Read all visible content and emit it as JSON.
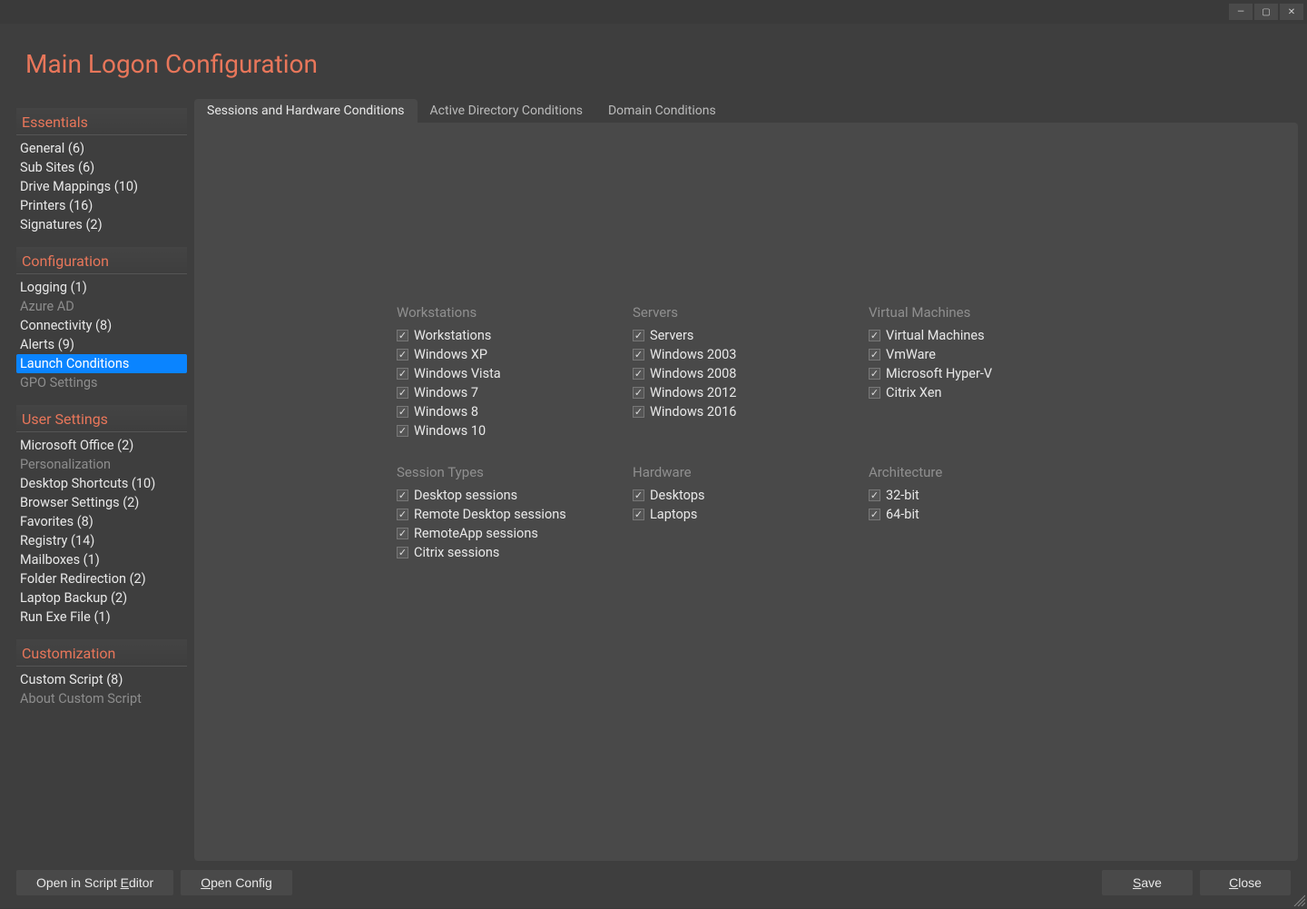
{
  "window": {
    "title": "Main Logon Configuration"
  },
  "sidebar": {
    "sections": [
      {
        "title": "Essentials",
        "items": [
          {
            "label": "General (6)",
            "muted": false
          },
          {
            "label": "Sub Sites (6)",
            "muted": false
          },
          {
            "label": "Drive Mappings (10)",
            "muted": false
          },
          {
            "label": "Printers (16)",
            "muted": false
          },
          {
            "label": "Signatures (2)",
            "muted": false
          }
        ]
      },
      {
        "title": "Configuration",
        "items": [
          {
            "label": "Logging (1)",
            "muted": false
          },
          {
            "label": "Azure AD",
            "muted": true
          },
          {
            "label": "Connectivity (8)",
            "muted": false
          },
          {
            "label": "Alerts (9)",
            "muted": false
          },
          {
            "label": "Launch Conditions",
            "muted": false,
            "selected": true
          },
          {
            "label": "GPO Settings",
            "muted": true
          }
        ]
      },
      {
        "title": "User Settings",
        "items": [
          {
            "label": "Microsoft Office (2)",
            "muted": false
          },
          {
            "label": "Personalization",
            "muted": true
          },
          {
            "label": "Desktop Shortcuts (10)",
            "muted": false
          },
          {
            "label": "Browser Settings (2)",
            "muted": false
          },
          {
            "label": "Favorites (8)",
            "muted": false
          },
          {
            "label": "Registry (14)",
            "muted": false
          },
          {
            "label": "Mailboxes (1)",
            "muted": false
          },
          {
            "label": "Folder Redirection (2)",
            "muted": false
          },
          {
            "label": "Laptop Backup (2)",
            "muted": false
          },
          {
            "label": "Run Exe File (1)",
            "muted": false
          }
        ]
      },
      {
        "title": "Customization",
        "items": [
          {
            "label": "Custom Script (8)",
            "muted": false
          },
          {
            "label": "About Custom Script",
            "muted": true
          }
        ]
      }
    ]
  },
  "tabs": [
    {
      "label": "Sessions and Hardware Conditions",
      "active": true
    },
    {
      "label": "Active Directory Conditions",
      "active": false
    },
    {
      "label": "Domain Conditions",
      "active": false
    }
  ],
  "groups": {
    "row1": [
      {
        "title": "Workstations",
        "items": [
          {
            "label": "Workstations",
            "checked": true
          },
          {
            "label": "Windows XP",
            "checked": true
          },
          {
            "label": "Windows Vista",
            "checked": true
          },
          {
            "label": "Windows 7",
            "checked": true
          },
          {
            "label": "Windows 8",
            "checked": true
          },
          {
            "label": "Windows 10",
            "checked": true
          }
        ]
      },
      {
        "title": "Servers",
        "items": [
          {
            "label": "Servers",
            "checked": true
          },
          {
            "label": "Windows 2003",
            "checked": true
          },
          {
            "label": "Windows 2008",
            "checked": true
          },
          {
            "label": "Windows 2012",
            "checked": true
          },
          {
            "label": "Windows 2016",
            "checked": true
          }
        ]
      },
      {
        "title": "Virtual Machines",
        "items": [
          {
            "label": "Virtual Machines",
            "checked": true
          },
          {
            "label": "VmWare",
            "checked": true
          },
          {
            "label": "Microsoft Hyper-V",
            "checked": true
          },
          {
            "label": "Citrix Xen",
            "checked": true
          }
        ]
      }
    ],
    "row2": [
      {
        "title": "Session Types",
        "items": [
          {
            "label": "Desktop sessions",
            "checked": true
          },
          {
            "label": "Remote Desktop sessions",
            "checked": true
          },
          {
            "label": "RemoteApp sessions",
            "checked": true
          },
          {
            "label": "Citrix sessions",
            "checked": true
          }
        ]
      },
      {
        "title": "Hardware",
        "items": [
          {
            "label": "Desktops",
            "checked": true
          },
          {
            "label": "Laptops",
            "checked": true
          }
        ]
      },
      {
        "title": "Architecture",
        "items": [
          {
            "label": "32-bit",
            "checked": true
          },
          {
            "label": "64-bit",
            "checked": true
          }
        ]
      }
    ]
  },
  "footer": {
    "open_editor": "Open in Script Editor",
    "open_config": "Open Config",
    "save": "Save",
    "close": "Close"
  }
}
